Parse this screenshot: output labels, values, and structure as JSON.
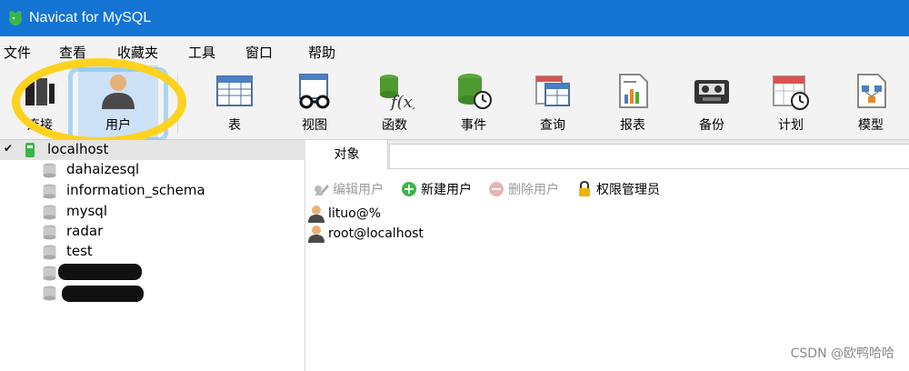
{
  "window": {
    "title": "Navicat for MySQL",
    "icon": "navicat-dolphin-icon"
  },
  "menu": [
    "文件",
    "查看",
    "收藏夹",
    "工具",
    "窗口",
    "帮助"
  ],
  "toolbar": {
    "connect": "连接",
    "user": "用户",
    "table": "表",
    "view": "视图",
    "function": "函数",
    "event": "事件",
    "query": "查询",
    "report": "报表",
    "backup": "备份",
    "schedule": "计划",
    "model": "模型",
    "active": "user"
  },
  "tree": {
    "connection": "localhost",
    "databases": [
      "dahaizesql",
      "information_schema",
      "mysql",
      "radar",
      "test"
    ]
  },
  "objects": {
    "tab": "对象",
    "edit_user": "编辑用户",
    "new_user": "新建用户",
    "delete_user": "删除用户",
    "privilege_manager": "权限管理员",
    "users": [
      "lituo@%",
      "root@localhost"
    ]
  },
  "watermark": "CSDN @欧鸭哈哈",
  "colors": {
    "titlebar": "#1474d4",
    "highlight": "#ffd21e",
    "active_tool": "#cde1f7"
  }
}
